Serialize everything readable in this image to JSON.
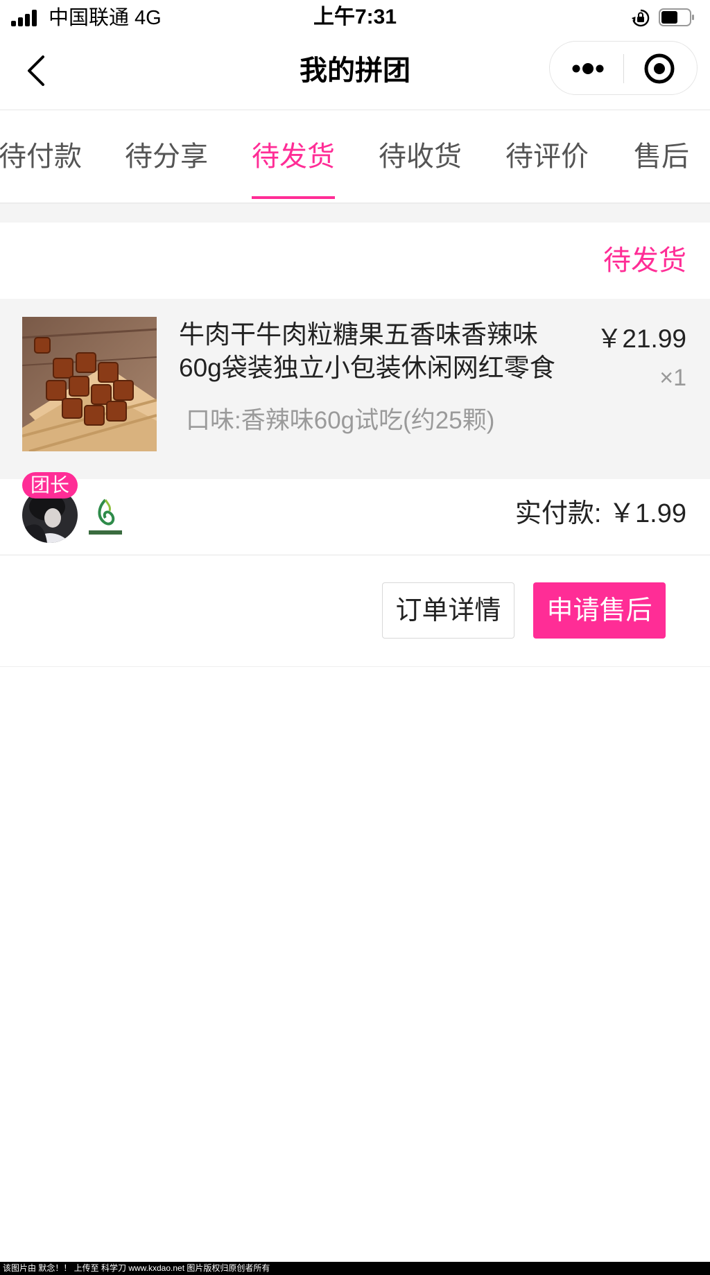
{
  "status_bar": {
    "carrier": "中国联通  4G",
    "time": "上午7:31"
  },
  "nav": {
    "title": "我的拼团"
  },
  "tabs": [
    {
      "label": "待付款",
      "active": false
    },
    {
      "label": "待分享",
      "active": false
    },
    {
      "label": "待发货",
      "active": true
    },
    {
      "label": "待收货",
      "active": false
    },
    {
      "label": "待评价",
      "active": false
    },
    {
      "label": "售后",
      "active": false
    }
  ],
  "order": {
    "status": "待发货",
    "product": {
      "title": "牛肉干牛肉粒糖果五香味香辣味60g袋装独立小包装休闲网红零食",
      "price": "￥21.99",
      "quantity": "×1",
      "spec": "口味:香辣味60g试吃(约25颗)"
    },
    "leader_badge": "团长",
    "paid_amount": "实付款: ￥1.99",
    "buttons": {
      "detail": "订单详情",
      "after_sale": "申请售后"
    }
  },
  "colors": {
    "accent": "#ff2d96",
    "tab_inactive": "#555555",
    "gray_bg": "#f4f4f4"
  },
  "icons": {
    "back": "chevron-left-icon",
    "more": "more-dots-icon",
    "close": "target-circle-icon"
  },
  "footer": {
    "text": "该图片由 默念！！ 上传至 科学刀 www.kxdao.net 图片版权归原创者所有"
  }
}
